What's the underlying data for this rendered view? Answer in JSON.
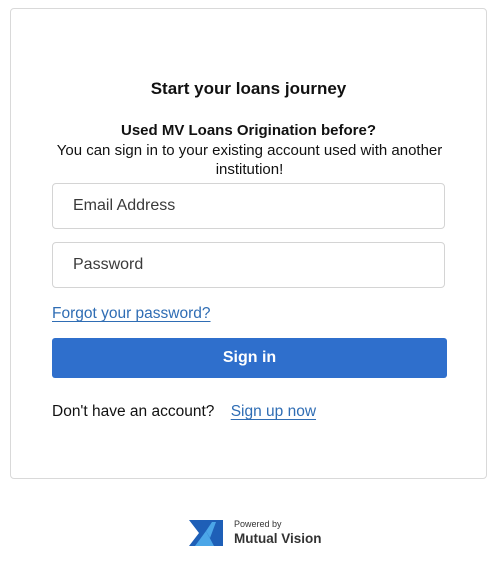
{
  "login": {
    "title": "Start your loans journey",
    "subtitle": "Used MV Loans Origination before?",
    "description": "You can sign in to your existing account used with another institution!",
    "email": {
      "placeholder": "Email Address",
      "value": ""
    },
    "password": {
      "placeholder": "Password",
      "value": ""
    },
    "forgot_label": "Forgot your password?",
    "signin_label": "Sign in",
    "no_account_text": "Don't have an account?",
    "signup_label": "Sign up now"
  },
  "footer": {
    "powered_by": "Powered by",
    "brand": "Mutual Vision",
    "logo_icon": "mutual-vision-logo-icon"
  },
  "colors": {
    "primary": "#2f6fcc",
    "link": "#2f6db4",
    "logo_dark": "#1e5fb7",
    "logo_light": "#4ba6e8"
  }
}
